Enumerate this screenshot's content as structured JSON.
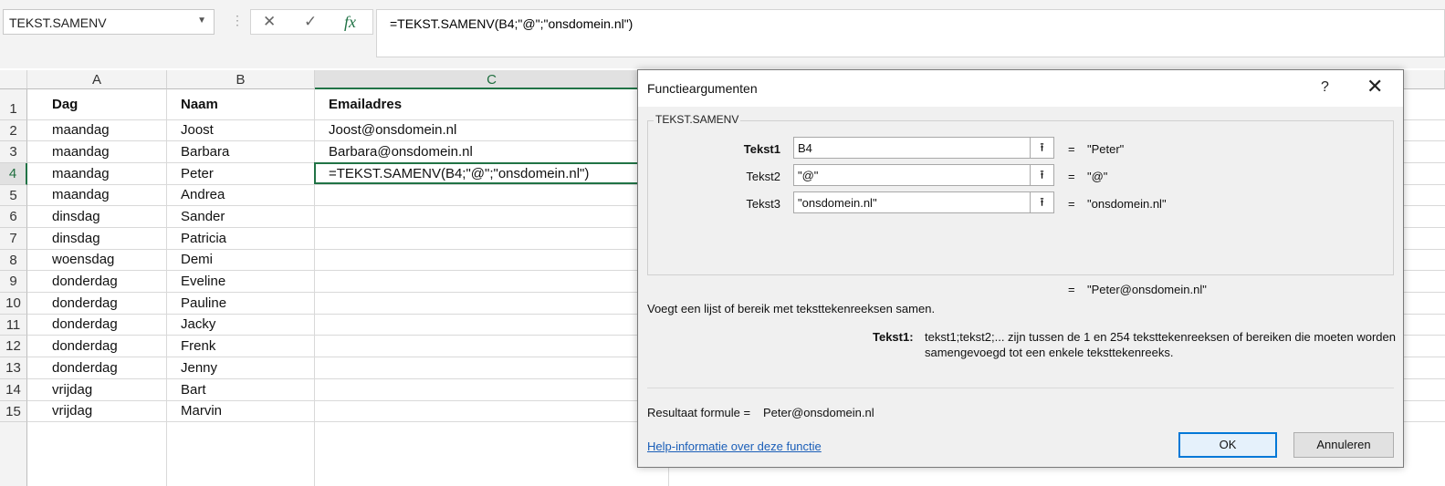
{
  "namebox": {
    "value": "TEKST.SAMENV"
  },
  "formula_bar": {
    "cancel_icon": "✕",
    "enter_icon": "✓",
    "fx_icon": "fx",
    "formula": "=TEKST.SAMENV(B4;\"@\";\"onsdomein.nl\")"
  },
  "columns": [
    "A",
    "B",
    "C"
  ],
  "rows": [
    {
      "num": "1",
      "a": "Dag",
      "b": "Naam",
      "c": "Emailadres"
    },
    {
      "num": "2",
      "a": "maandag",
      "b": "Joost",
      "c": "Joost@onsdomein.nl"
    },
    {
      "num": "3",
      "a": "maandag",
      "b": "Barbara",
      "c": "Barbara@onsdomein.nl"
    },
    {
      "num": "4",
      "a": "maandag",
      "b": "Peter",
      "c": "=TEKST.SAMENV(B4;\"@\";\"onsdomein.nl\")"
    },
    {
      "num": "5",
      "a": "maandag",
      "b": "Andrea",
      "c": ""
    },
    {
      "num": "6",
      "a": "dinsdag",
      "b": "Sander",
      "c": ""
    },
    {
      "num": "7",
      "a": "dinsdag",
      "b": "Patricia",
      "c": ""
    },
    {
      "num": "8",
      "a": "woensdag",
      "b": "Demi",
      "c": ""
    },
    {
      "num": "9",
      "a": "donderdag",
      "b": "Eveline",
      "c": ""
    },
    {
      "num": "10",
      "a": "donderdag",
      "b": "Pauline",
      "c": ""
    },
    {
      "num": "11",
      "a": "donderdag",
      "b": "Jacky",
      "c": ""
    },
    {
      "num": "12",
      "a": "donderdag",
      "b": "Frenk",
      "c": ""
    },
    {
      "num": "13",
      "a": "donderdag",
      "b": "Jenny",
      "c": ""
    },
    {
      "num": "14",
      "a": "vrijdag",
      "b": "Bart",
      "c": ""
    },
    {
      "num": "15",
      "a": "vrijdag",
      "b": "Marvin",
      "c": ""
    }
  ],
  "dialog": {
    "title": "Functieargumenten",
    "help_icon": "?",
    "close_icon": "✕",
    "group_title": "TEKST.SAMENV",
    "args": [
      {
        "label": "Tekst1",
        "value": "B4",
        "result": "\"Peter\""
      },
      {
        "label": "Tekst2",
        "value": "\"@\"",
        "result": "\"@\""
      },
      {
        "label": "Tekst3",
        "value": "\"onsdomein.nl\"",
        "result": "\"onsdomein.nl\""
      }
    ],
    "collapse_icon": "⭱",
    "equals": "=",
    "overall_result": "\"Peter@onsdomein.nl\"",
    "description": "Voegt een lijst of bereik met teksttekenreeksen samen.",
    "arg_help_label": "Tekst1:",
    "arg_help_line1": "tekst1;tekst2;... zijn tussen de 1 en 254 teksttekenreeksen of bereiken die moeten worden",
    "arg_help_line2": "samengevoegd tot een enkele teksttekenreeks.",
    "result_label": "Resultaat formule =",
    "result_value": "Peter@onsdomein.nl",
    "help_link": "Help-informatie over deze functie",
    "ok_label": "OK",
    "cancel_label": "Annuleren"
  }
}
